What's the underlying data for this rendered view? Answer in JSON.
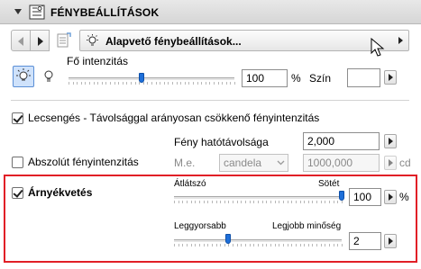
{
  "header": {
    "title": "FÉNYBEÁLLÍTÁSOK"
  },
  "navbar": {
    "preset_label": "Alapvető fénybeállítások..."
  },
  "intensity": {
    "label": "Fő intenzitás",
    "value": "100",
    "unit": "%",
    "level": 0.44,
    "color_label": "Szín"
  },
  "falloff": {
    "checkbox_label": "Lecsengés - Távolsággal arányosan csökkenő fényintenzitás",
    "checked": true,
    "distance_label": "Fény hatótávolsága",
    "distance_value": "2,000"
  },
  "absolute": {
    "checkbox_label": "Abszolút fényintenzitás",
    "checked": false,
    "unit_label": "M.e.",
    "unit_value": "candela",
    "value": "1000,000",
    "unit": "cd"
  },
  "shadow": {
    "checkbox_label": "Árnyékvetés",
    "checked": true,
    "opacity": {
      "left_label": "Átlátszó",
      "right_label": "Sötét",
      "value": "100",
      "unit": "%",
      "level": 1.0
    },
    "quality": {
      "left_label": "Leggyorsabb",
      "right_label": "Legjobb minőség",
      "value": "2",
      "level": 0.32
    }
  },
  "colors": {
    "highlight": "#e11f26",
    "slider_thumb": "#1e6fd9",
    "selected_button": "#cfe2fb"
  }
}
